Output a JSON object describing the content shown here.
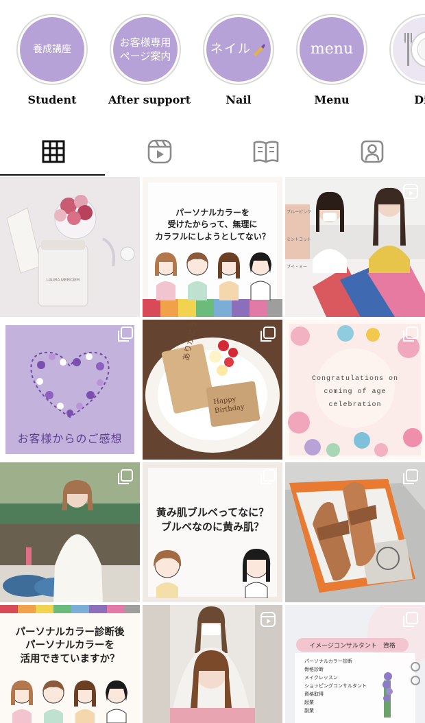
{
  "highlights": [
    {
      "inner": "養成講座",
      "label": "Student"
    },
    {
      "inner": "お客様専用ページ案内",
      "line1": "お客様専用",
      "line2": "ページ案内",
      "label": "After support"
    },
    {
      "inner": "ネイル",
      "label": "Nail"
    },
    {
      "inner": "menu",
      "label": "Menu"
    },
    {
      "inner": "",
      "label": "Din"
    }
  ],
  "tabs": [
    {
      "name": "posts",
      "icon": "grid-icon",
      "active": true
    },
    {
      "name": "reels",
      "icon": "reels-icon",
      "active": false
    },
    {
      "name": "guides",
      "icon": "guide-book-icon",
      "active": false
    },
    {
      "name": "tagged",
      "icon": "tagged-user-icon",
      "active": false
    }
  ],
  "posts": {
    "p1": {
      "product_label": "LAURA MERCIER"
    },
    "p2": {
      "line1": "パーソナルカラーを",
      "line2": "受けたからって、無理に",
      "line3": "カラフルにしようとしてない？"
    },
    "p3": {
      "tag1": "ブルーピンク",
      "tag2": "ミントコット",
      "tag3": "ブイ・ミー"
    },
    "p4": {
      "caption": "お客様からのご感想"
    },
    "p5": {
      "card1": "ありがとう",
      "card2": "Happy Birthday"
    },
    "p6": {
      "line1": "Congratulations on",
      "line2": "coming of age",
      "line3": "celebration"
    },
    "p8": {
      "line1": "黄み肌ブルベってなに？",
      "line2": "ブルベなのに黄み肌？"
    },
    "p10": {
      "line1": "パーソナルカラー診断後",
      "line2": "パーソナルカラーを",
      "line3": "活用できていますか？"
    },
    "p12": {
      "title": "イメージコンサルタント　資格",
      "items": [
        "パーソナルカラー診断",
        "骨格診断",
        "メイクレッスン",
        "ショッピングコンサルタント",
        "資格取得",
        "起業",
        "副業"
      ]
    }
  },
  "colors": {
    "highlight_purple": "#b6a2d6",
    "text": "#111111",
    "divider": "#d9d9d9"
  }
}
